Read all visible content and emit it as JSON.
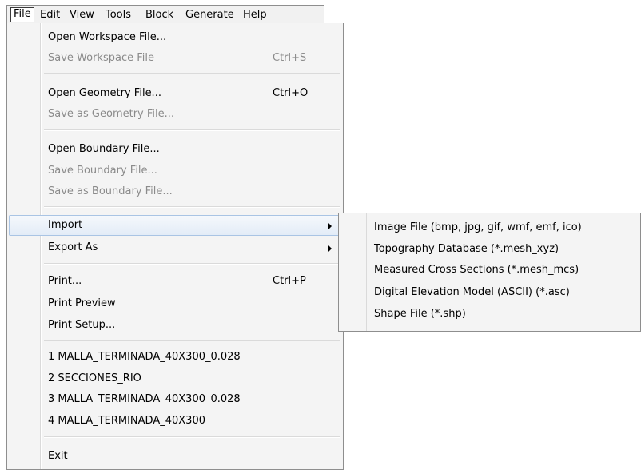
{
  "menubar": {
    "items": [
      "File",
      "Edit",
      "View",
      "Tools",
      "Block",
      "Generate",
      "Help"
    ]
  },
  "file_menu": {
    "items": [
      {
        "label": "Open Workspace File...",
        "shortcut": "",
        "enabled": true
      },
      {
        "label": "Save Workspace File",
        "shortcut": "Ctrl+S",
        "enabled": false
      },
      {
        "label": "Open Geometry File...",
        "shortcut": "Ctrl+O",
        "enabled": true
      },
      {
        "label": "Save as Geometry File...",
        "shortcut": "",
        "enabled": false
      },
      {
        "label": "Open Boundary File...",
        "shortcut": "",
        "enabled": true
      },
      {
        "label": "Save Boundary File...",
        "shortcut": "",
        "enabled": false
      },
      {
        "label": "Save as Boundary File...",
        "shortcut": "",
        "enabled": false
      },
      {
        "label": "Import",
        "shortcut": "",
        "enabled": true,
        "submenu": true,
        "highlighted": true
      },
      {
        "label": "Export As",
        "shortcut": "",
        "enabled": true,
        "submenu": true
      },
      {
        "label": "Print...",
        "shortcut": "Ctrl+P",
        "enabled": true
      },
      {
        "label": "Print Preview",
        "shortcut": "",
        "enabled": true
      },
      {
        "label": "Print Setup...",
        "shortcut": "",
        "enabled": true
      },
      {
        "label": "1 MALLA_TERMINADA_40X300_0.028",
        "shortcut": "",
        "enabled": true
      },
      {
        "label": "2 SECCIONES_RIO",
        "shortcut": "",
        "enabled": true
      },
      {
        "label": "3 MALLA_TERMINADA_40X300_0.028",
        "shortcut": "",
        "enabled": true
      },
      {
        "label": "4 MALLA_TERMINADA_40X300",
        "shortcut": "",
        "enabled": true
      },
      {
        "label": "Exit",
        "shortcut": "",
        "enabled": true
      }
    ]
  },
  "import_submenu": {
    "items": [
      "Image File (bmp, jpg, gif, wmf, emf, ico)",
      "Topography Database (*.mesh_xyz)",
      "Measured Cross Sections (*.mesh_mcs)",
      "Digital Elevation Model (ASCII) (*.asc)",
      "Shape File (*.shp)"
    ]
  }
}
